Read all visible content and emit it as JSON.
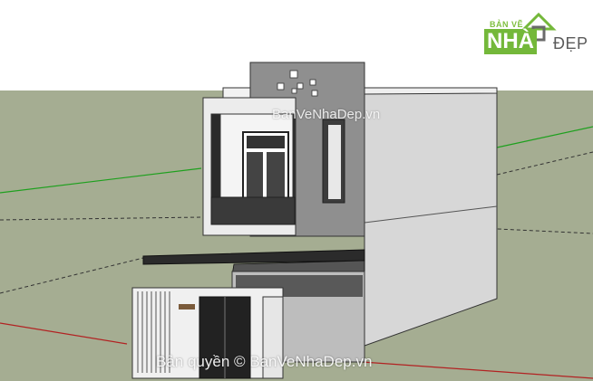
{
  "watermark": {
    "center": "BanVeNhaDep.vn",
    "bottom": "Bản quyền © BanVeNhaDep.vn"
  },
  "logo": {
    "top_text": "BẢN VẼ",
    "nha_text": "NHÀ",
    "dep_text": "ĐẸP"
  },
  "colors": {
    "ground": "#a5ad92",
    "accent_green": "#74b83a"
  }
}
